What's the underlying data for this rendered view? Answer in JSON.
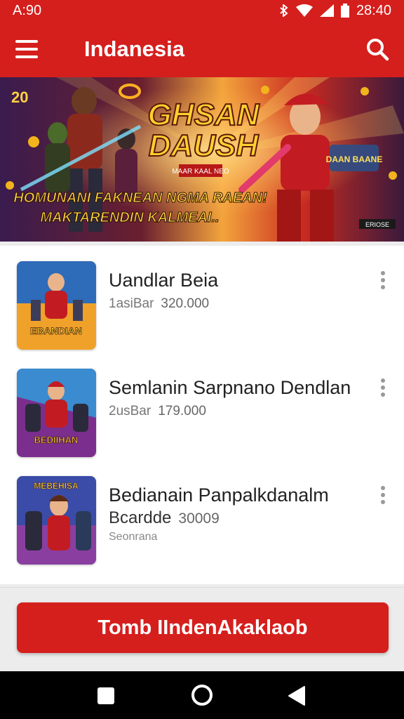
{
  "status_bar": {
    "time": "A:90",
    "right_text": "28:40"
  },
  "app_bar": {
    "title": "Indanesia",
    "menu_icon": "menu-icon",
    "search_icon": "search-icon"
  },
  "banner": {
    "corner_label": "20",
    "title_line1": "GHSAN",
    "title_line2": "DAUSH",
    "tagline_line1": "HOMUNANI FAKNEAN NGMA RAEAN!",
    "tagline_line2": "MAKTARENDIN KALMEAI..",
    "badge_text": "MAAR KAAL NEO",
    "right_badge": "DAAN BAANE",
    "corner_tag": "ERIOSE"
  },
  "list": [
    {
      "title": "Uandlar Beia",
      "meta_label": "1asiBar",
      "meta_value": "320.000",
      "sub": "",
      "thumb_text": "EBANDIAN"
    },
    {
      "title": "Semlanin Sarpnano Dendlan",
      "meta_label": "2usBar",
      "meta_value": "179.000",
      "sub": "",
      "thumb_text": "BEDIIHAN"
    },
    {
      "title": "Bedianain Panpalkdanalm",
      "meta_label": "Bcardde",
      "meta_value": "30009",
      "sub": "Seonrana",
      "thumb_text": "MEBEHISA"
    }
  ],
  "cta": {
    "label": "Tomb IIndenAkaklaob"
  },
  "colors": {
    "primary": "#d51f1d",
    "background": "#ececec"
  }
}
